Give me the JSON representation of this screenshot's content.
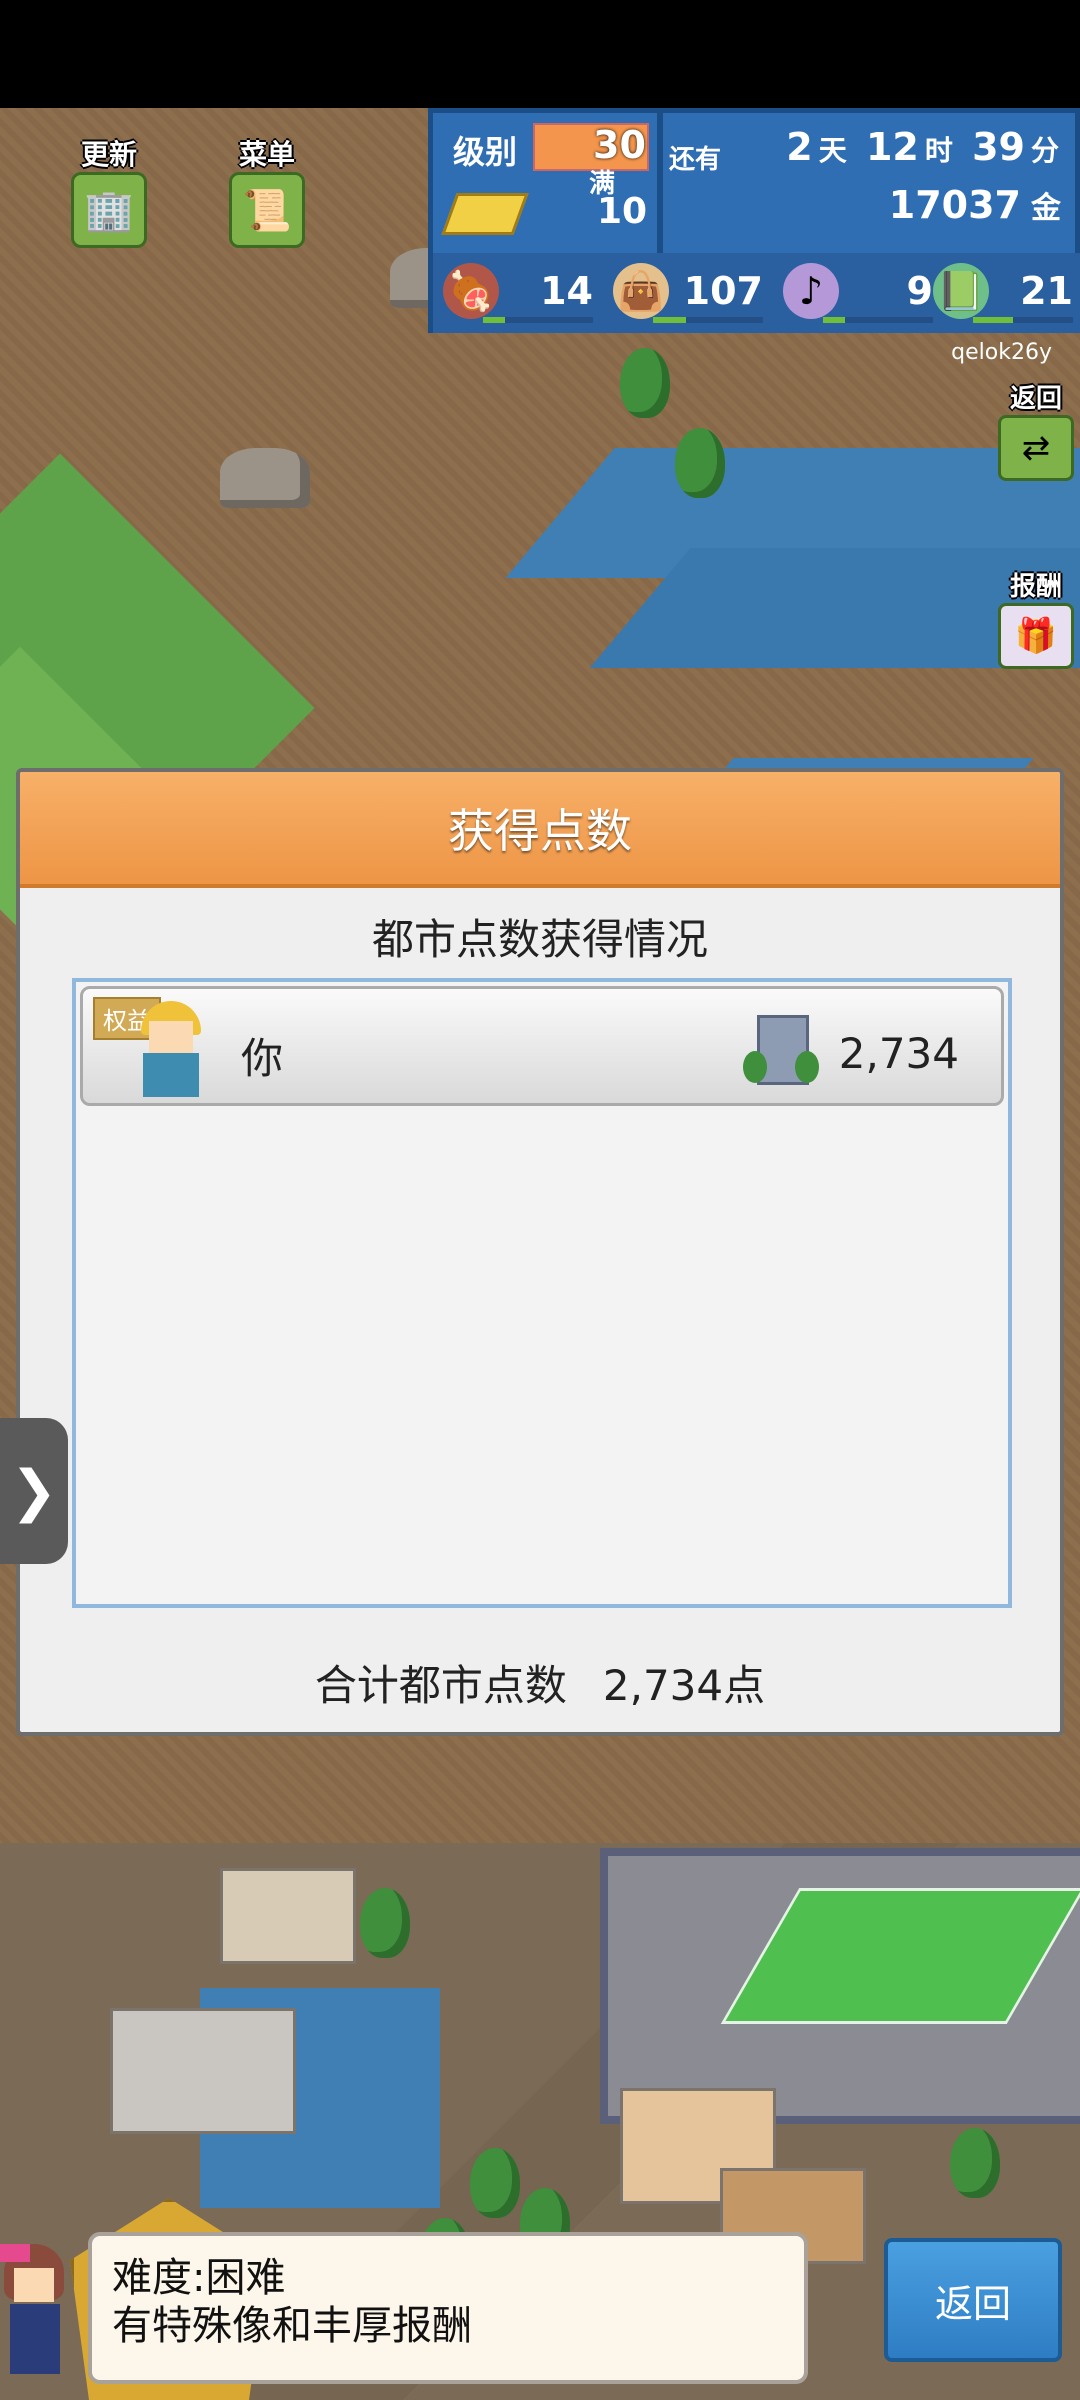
{
  "hud": {
    "update_label": "更新",
    "menu_label": "菜单"
  },
  "stats": {
    "level_label": "级别",
    "level_value": "30",
    "level_max_label": "满",
    "level_sub": "10",
    "remaining_label": "还有",
    "days": "2",
    "days_unit": "天",
    "hours": "12",
    "hours_unit": "时",
    "minutes": "39",
    "minutes_unit": "分",
    "gold": "17037",
    "gold_unit": "金",
    "items": [
      {
        "icon": "food-icon",
        "value": "14",
        "fill": 0.2
      },
      {
        "icon": "bag-icon",
        "value": "107",
        "fill": 0.3
      },
      {
        "icon": "music-icon",
        "value": "9",
        "fill": 0.2
      },
      {
        "icon": "book-icon",
        "value": "21",
        "fill": 0.4
      }
    ]
  },
  "username": "qelok26y",
  "side": {
    "return_label": "返回",
    "reward_label": "报酬"
  },
  "dialog": {
    "title": "获得点数",
    "subtitle": "都市点数获得情况",
    "rows": [
      {
        "badge": "权益",
        "name": "你",
        "points": "2,734"
      }
    ],
    "total_label": "合计都市点数",
    "total_value": "2,734点"
  },
  "info": {
    "line1": "难度:困难",
    "line2": "有特殊像和丰厚报酬"
  },
  "back_button": "返回",
  "colors": {
    "dialog_header": "#ee9546",
    "stats_panel": "#2f6eb3",
    "back_button": "#2e7dc4"
  }
}
